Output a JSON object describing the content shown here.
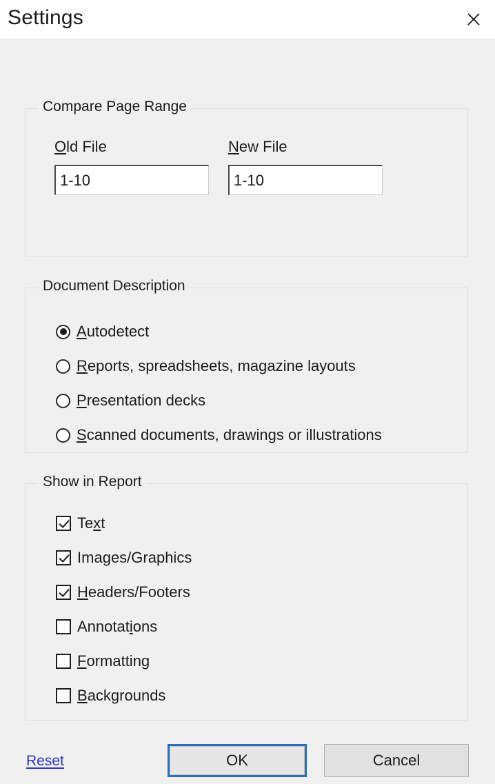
{
  "window": {
    "title": "Settings",
    "close_icon": "close-icon"
  },
  "page_range": {
    "legend": "Compare Page Range",
    "old_file": {
      "label_accel": "O",
      "label_rest": "ld File",
      "value": "1-10"
    },
    "new_file": {
      "label_accel": "N",
      "label_rest": "ew File",
      "value": "1-10"
    }
  },
  "document_description": {
    "legend": "Document Description",
    "options": [
      {
        "pre": "",
        "accel": "A",
        "post": "utodetect",
        "checked": true
      },
      {
        "pre": "",
        "accel": "R",
        "post": "eports, spreadsheets, magazine layouts",
        "checked": false
      },
      {
        "pre": "",
        "accel": "P",
        "post": "resentation decks",
        "checked": false
      },
      {
        "pre": "",
        "accel": "S",
        "post": "canned documents, drawings or illustrations",
        "checked": false
      }
    ]
  },
  "show_in_report": {
    "legend": "Show in Report",
    "items": [
      {
        "pre": "Te",
        "accel": "x",
        "post": "t",
        "checked": true
      },
      {
        "pre": "Ima",
        "accel": "g",
        "post": "es/Graphics",
        "checked": true
      },
      {
        "pre": "",
        "accel": "H",
        "post": "eaders/Footers",
        "checked": true
      },
      {
        "pre": "Annotat",
        "accel": "i",
        "post": "ons",
        "checked": false
      },
      {
        "pre": "",
        "accel": "F",
        "post": "ormatting",
        "checked": false
      },
      {
        "pre": "",
        "accel": "B",
        "post": "ackgrounds",
        "checked": false
      }
    ]
  },
  "footer": {
    "reset_label": "Reset",
    "ok_label": "OK",
    "cancel_label": "Cancel"
  },
  "colors": {
    "dialog_background": "#f0f0f0",
    "titlebar_background": "#ffffff",
    "accent_focus": "#2a6fba",
    "link": "#2b35c4",
    "group_border": "#dedede",
    "button_face": "#e1e1e1"
  }
}
